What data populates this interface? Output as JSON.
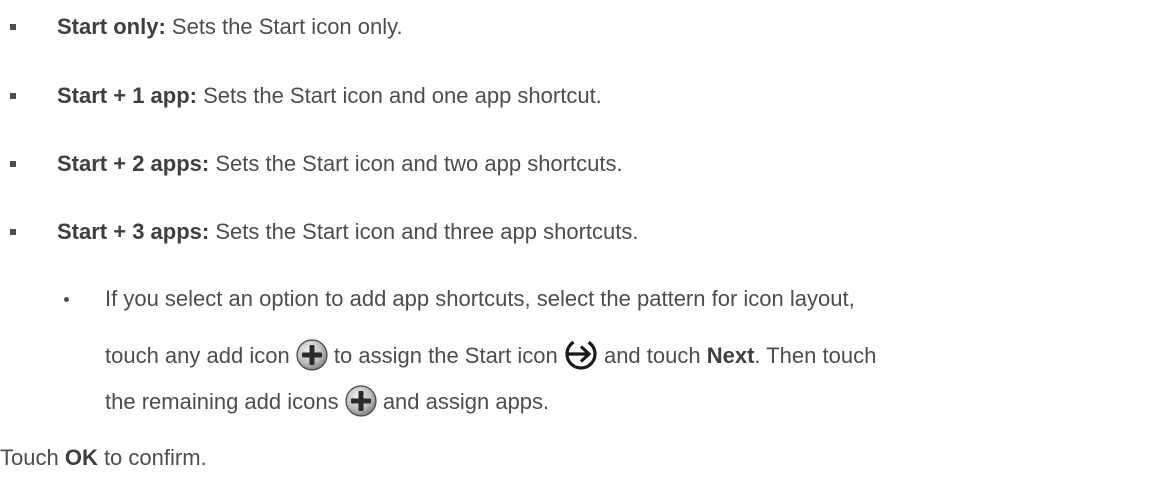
{
  "options": [
    {
      "lead": "Start only:",
      "text": " Sets the Start icon only."
    },
    {
      "lead": "Start + 1 app:",
      "text": " Sets the Start icon and one app shortcut."
    },
    {
      "lead": "Start + 2 apps:",
      "text": " Sets the Start icon and two app shortcuts."
    },
    {
      "lead": "Start + 3 apps:",
      "text": " Sets the Start icon and three app shortcuts."
    }
  ],
  "sub_bullet": {
    "line1": "If you select an option to add app shortcuts, select the pattern for icon layout,",
    "line2_a": "touch any add icon ",
    "line2_b": " to assign the Start icon ",
    "line2_c": " and touch ",
    "line2_bold": "Next",
    "line2_d": ". Then touch",
    "line3_a": "the remaining add icons ",
    "line3_b": " and assign apps."
  },
  "confirm": {
    "a": "Touch ",
    "bold": "OK",
    "b": " to confirm."
  },
  "icons": {
    "add": "add-icon",
    "start": "start-arrow-icon"
  }
}
